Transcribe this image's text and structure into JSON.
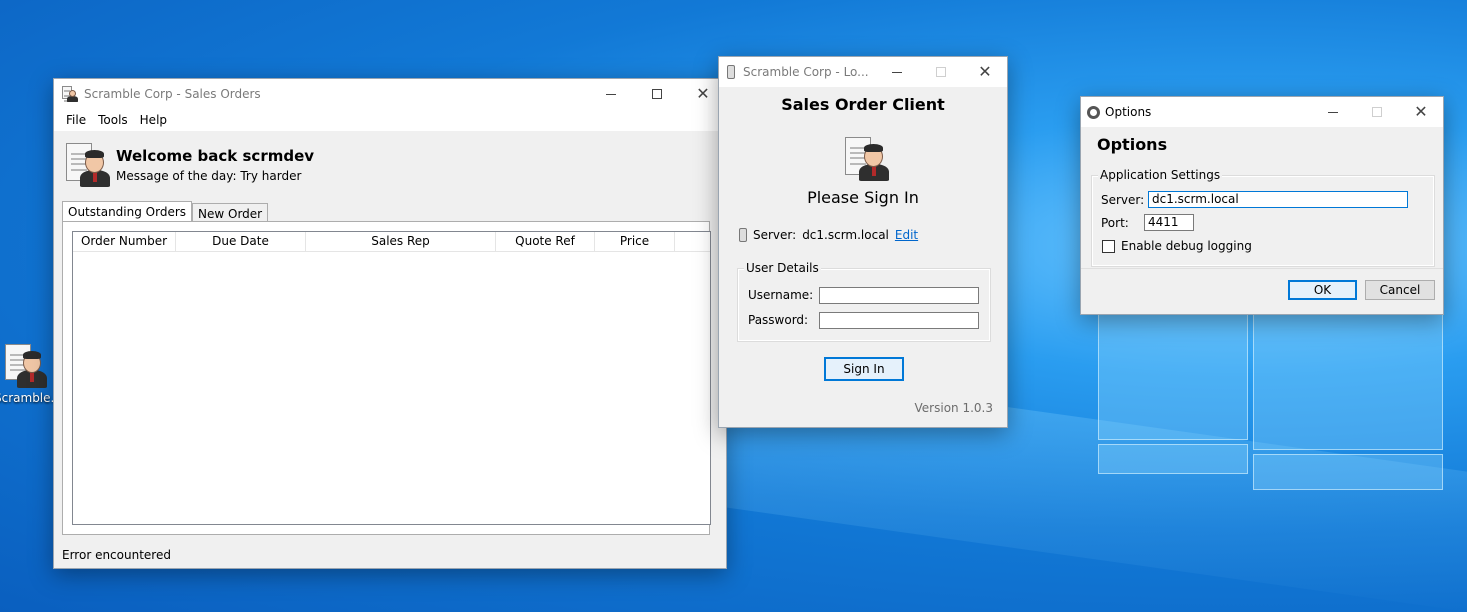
{
  "desktop": {
    "icon_label": "Scramble..."
  },
  "main_window": {
    "title": "Scramble Corp - Sales Orders",
    "menu": [
      "File",
      "Tools",
      "Help"
    ],
    "welcome": "Welcome back scrmdev",
    "motd": "Message of the day: Try harder",
    "tabs": [
      "Outstanding Orders",
      "New Order"
    ],
    "columns": [
      "Order Number",
      "Due Date",
      "Sales Rep",
      "Quote Ref",
      "Price"
    ],
    "status": "Error encountered"
  },
  "login_window": {
    "title": "Scramble Corp - Lo...",
    "heading": "Sales Order Client",
    "please": "Please Sign In",
    "server_label": "Server:",
    "server_value": "dc1.scrm.local",
    "edit_link": "Edit",
    "group_title": "User Details",
    "username_label": "Username:",
    "username_value": "",
    "password_label": "Password:",
    "password_value": "",
    "sign_in": "Sign In",
    "version": "Version 1.0.3"
  },
  "options_window": {
    "title": "Options",
    "heading": "Options",
    "group_title": "Application Settings",
    "server_label": "Server:",
    "server_value": "dc1.scrm.local",
    "port_label": "Port:",
    "port_value": "4411",
    "debug_label": "Enable debug logging",
    "debug_checked": false,
    "ok": "OK",
    "cancel": "Cancel"
  },
  "colors": {
    "desktop": "#1279d6",
    "accent": "#0078d7",
    "link": "#0066cc",
    "window_bg": "#f0f0f0"
  }
}
